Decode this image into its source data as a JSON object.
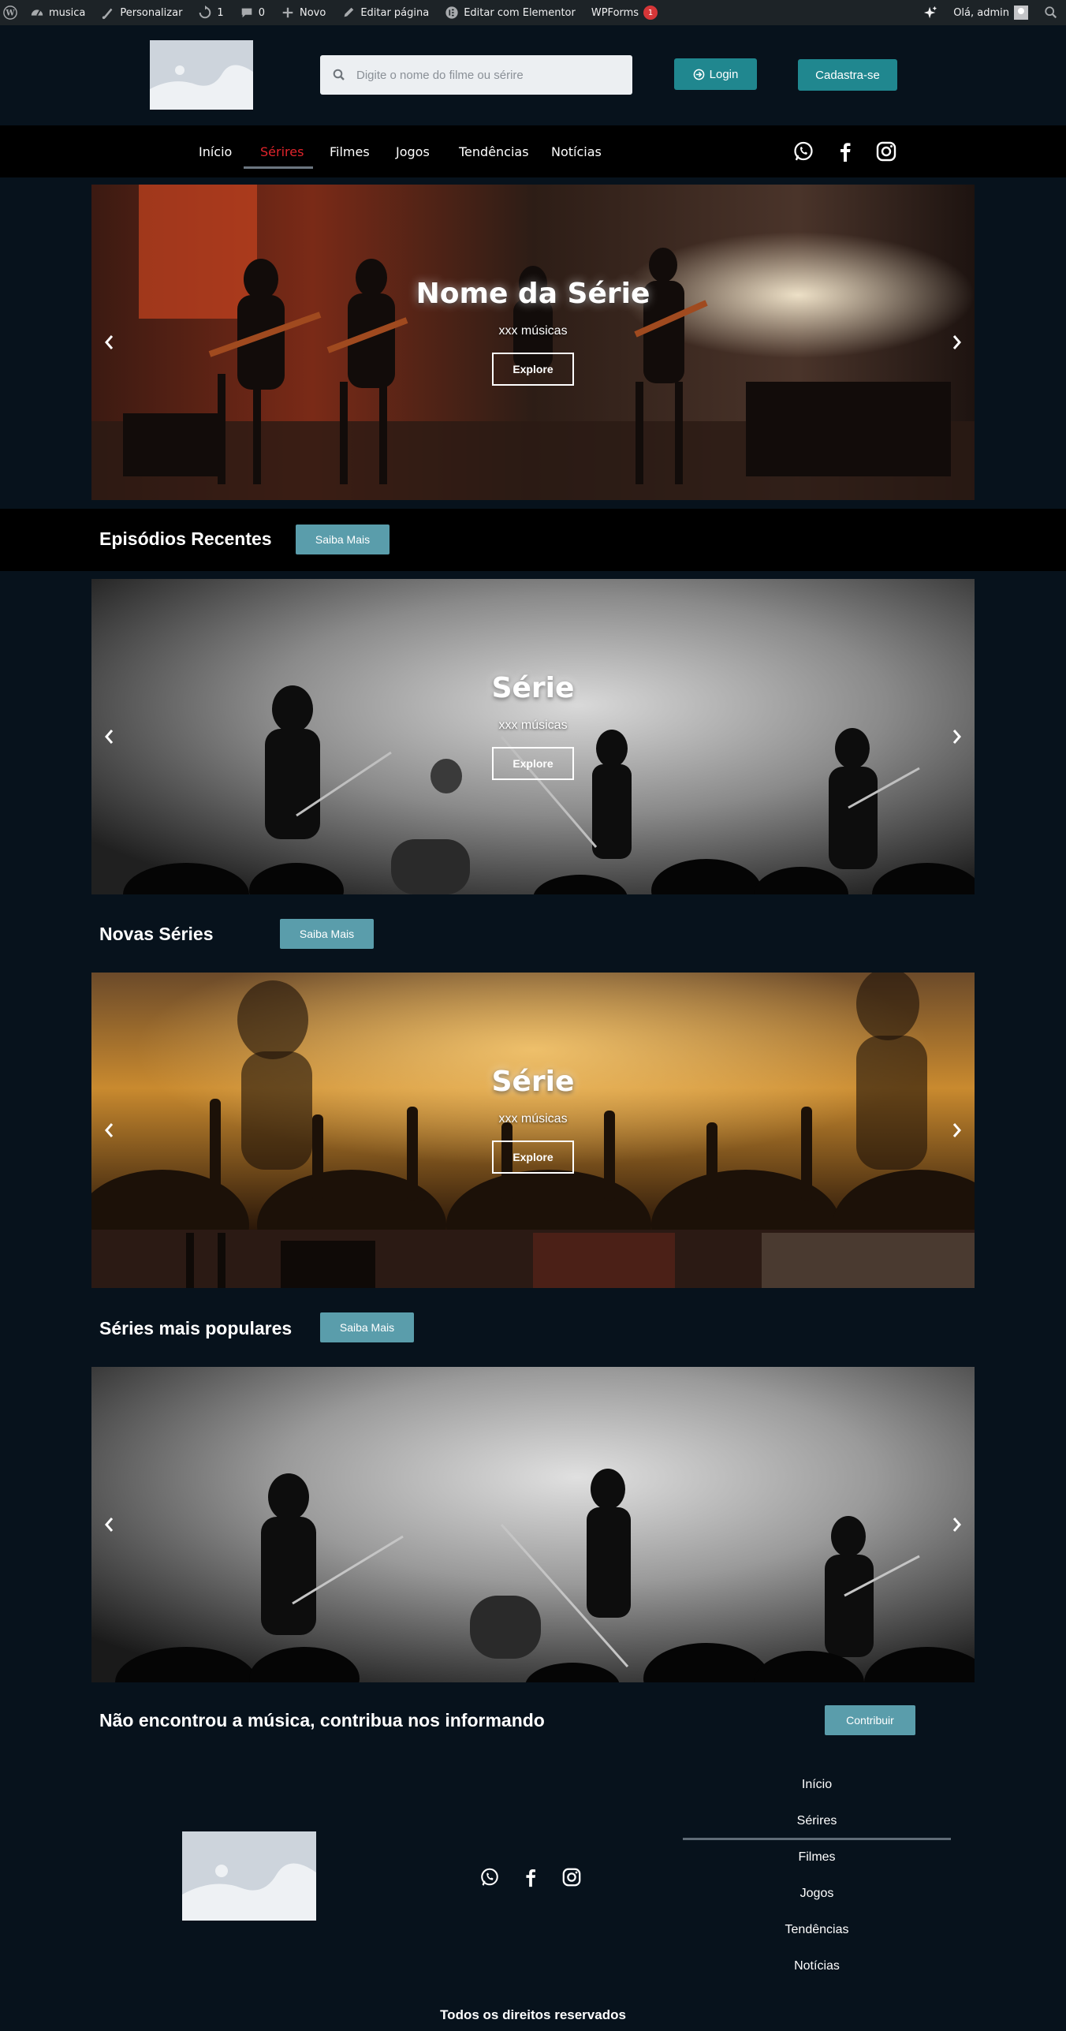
{
  "adminbar": {
    "site_name": "musica",
    "customize": "Personalizar",
    "updates_count": "1",
    "comments_count": "0",
    "new": "Novo",
    "edit_page": "Editar página",
    "edit_elementor": "Editar com Elementor",
    "wpforms": "WPForms",
    "wpforms_badge": "1",
    "greeting": "Olá, admin"
  },
  "header": {
    "search_placeholder": "Digite o nome do filme ou sérire",
    "login_label": "Login",
    "signup_label": "Cadastra-se",
    "accent_color": "#20878f"
  },
  "nav": {
    "items": [
      {
        "label": "Início"
      },
      {
        "label": "Sérires"
      },
      {
        "label": "Filmes"
      },
      {
        "label": "Jogos"
      },
      {
        "label": "Tendências"
      },
      {
        "label": "Notícias"
      }
    ],
    "active_color": "#e0242b",
    "social_icons": [
      "whatsapp-icon",
      "facebook-icon",
      "instagram-icon"
    ]
  },
  "slides": [
    {
      "title": "Nome da Série",
      "subtitle": "xxx músicas",
      "button": "Explore"
    },
    {
      "title": "Série",
      "subtitle": "xxx músicas",
      "button": "Explore"
    },
    {
      "title": "Série",
      "subtitle": "xxx músicas",
      "button": "Explore"
    },
    {
      "title": "",
      "subtitle": "",
      "button": ""
    }
  ],
  "sections": [
    {
      "title": "Episódios Recentes",
      "button": "Saiba Mais"
    },
    {
      "title": "Novas Séries",
      "button": "Saiba Mais"
    },
    {
      "title": "Séries mais populares",
      "button": "Saiba Mais"
    }
  ],
  "contribute": {
    "title": "Não encontrou a música, contribua nos informando",
    "button": "Contribuir"
  },
  "footer": {
    "links": [
      {
        "label": "Início"
      },
      {
        "label": "Sérires"
      },
      {
        "label": "Filmes"
      },
      {
        "label": "Jogos"
      },
      {
        "label": "Tendências"
      },
      {
        "label": "Notícias"
      }
    ],
    "copyright": "Todos os direitos reservados"
  }
}
